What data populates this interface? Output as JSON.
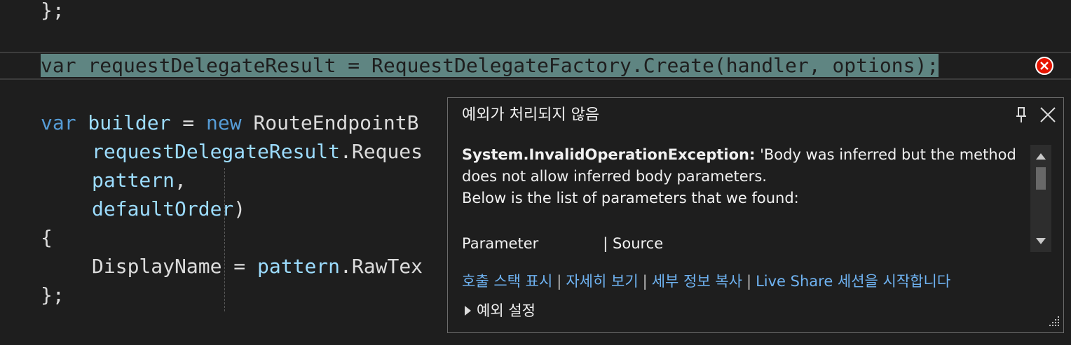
{
  "code": {
    "line_close_prev": "};",
    "hl_var": "var",
    "hl_rest": " requestDelegateResult = RequestDelegateFactory.Create(handler, options);",
    "b_var": "var",
    "b_builder": " builder",
    "b_eq": " = ",
    "b_new": "new",
    "b_type": " RouteEndpointB",
    "l_rdr": "requestDelegateResult",
    "l_reques": ".Reques",
    "l_pattern": "pattern",
    "l_comma": ",",
    "l_default": "defaultOrder",
    "l_paren": ")",
    "l_brace_open": "{",
    "l_display": "DisplayName",
    "l_eq2": " = ",
    "l_pattern2": "pattern",
    "l_rawtex": ".RawTex",
    "l_brace_close": "};"
  },
  "popup": {
    "title": "예외가 처리되지 않음",
    "exception_type": "System.InvalidOperationException:",
    "message_1": " 'Body was inferred but the method does not allow inferred body parameters.",
    "message_2": "Below is the list of parameters that we found:",
    "param_header_1": "Parameter",
    "param_header_2": "| Source",
    "links": [
      "호출 스택 표시",
      "자세히 보기",
      "세부 정보 복사",
      "Live Share 세션을 시작합니다"
    ],
    "settings_label": "예외 설정"
  },
  "colors": {
    "error": "#e51400",
    "link": "#6fb3f2",
    "highlight": "#5f8582"
  },
  "icons": [
    "error-icon",
    "pin-icon",
    "close-icon",
    "resize-grip-icon",
    "expand-triangle-icon"
  ]
}
